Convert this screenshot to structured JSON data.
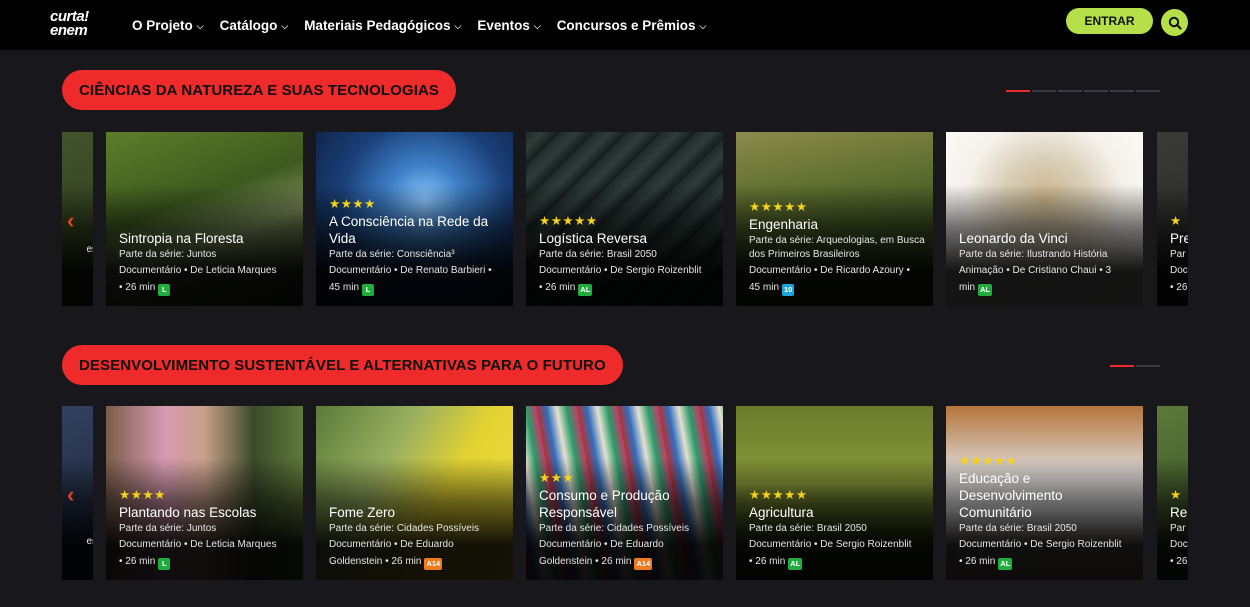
{
  "logo": {
    "line1": "curta!",
    "line2": "enem"
  },
  "nav": {
    "items": [
      {
        "label": "O Projeto"
      },
      {
        "label": "Catálogo"
      },
      {
        "label": "Materiais Pedagógicos"
      },
      {
        "label": "Eventos"
      },
      {
        "label": "Concursos e Prêmios"
      }
    ],
    "login_label": "ENTRAR"
  },
  "sections": [
    {
      "title": "CIÊNCIAS DA NATUREZA E SUAS TECNOLOGIAS",
      "pager": {
        "total": 6,
        "active": 1
      },
      "partial_left": {
        "meta": "es"
      },
      "cards": [
        {
          "stars": "",
          "title": "Sintropia na Floresta",
          "series": "Parte da série: Juntos",
          "meta1": "Documentário • De Leticia Marques",
          "meta2": "• 26 min",
          "rating": "L",
          "rating_color": "#1fae3b",
          "bg": "linear-gradient(160deg,#5e7d2b 0%,#3e5a1f 40%,#7a8a5a 60%,#2c3a14 100%)"
        },
        {
          "stars": "★★★★",
          "title": "A Consciência na Rede da Vida",
          "series": "Parte da série: Consciência³",
          "meta1": "Documentário • De Renato Barbieri •",
          "meta2": "45 min",
          "rating": "L",
          "rating_color": "#1fae3b",
          "bg": "radial-gradient(circle at 55% 40%,#8ec9ff 0%,#3d7fc7 25%,#1a3f78 55%,#0b1a36 100%)"
        },
        {
          "stars": "★★★★★",
          "title": "Logística Reversa",
          "series": "Parte da série: Brasil 2050",
          "meta1": "Documentário • De Sergio Roizenblit",
          "meta2": "• 26 min",
          "rating": "AL",
          "rating_color": "#1fae3b",
          "bg": "repeating-linear-gradient(135deg,#1e2a28 0px,#2f3d3a 12px,#141c1b 24px)"
        },
        {
          "stars": "★★★★★",
          "title": "Engenharia",
          "series": "Parte da série: Arqueologias, em Busca dos Primeiros Brasileiros",
          "meta1": "Documentário • De Ricardo Azoury •",
          "meta2": "45 min",
          "rating": "10",
          "rating_color": "#1aa3dc",
          "bg": "linear-gradient(170deg,#8b8b4a 0%,#5d6d2f 35%,#3f5422 60%,#2a3816 100%)"
        },
        {
          "stars": "",
          "title": "Leonardo da Vinci",
          "series": "Parte da série: Ilustrando História",
          "meta1": "Animação • De Cristiano Chaui • 3",
          "meta2": "min",
          "rating": "AL",
          "rating_color": "#1fae3b",
          "bg": "radial-gradient(circle at 50% 40%,#c9b48a 0%,#d9cfb8 30%,#f4f1ea 55%,#ffffff 100%)"
        }
      ],
      "partial_right": {
        "stars": "★",
        "title": "Pre",
        "series": "Par",
        "meta": "Doc",
        "meta2": "• 26"
      }
    },
    {
      "title": "DESENVOLVIMENTO SUSTENTÁVEL E ALTERNATIVAS PARA O FUTURO",
      "pager": {
        "total": 2,
        "active": 1
      },
      "partial_left": {
        "meta": "es"
      },
      "cards": [
        {
          "stars": "★★★★",
          "title": "Plantando nas Escolas",
          "series": "Parte da série: Juntos",
          "meta1": "Documentário • De Leticia Marques",
          "meta2": "• 26 min",
          "rating": "L",
          "rating_color": "#1fae3b",
          "bg": "linear-gradient(90deg,#7a5d4a 0%,#d89ab0 30%,#c8a08a 50%,#3b4a2a 75%,#5f7a3a 100%)"
        },
        {
          "stars": "",
          "title": "Fome Zero",
          "series": "Parte da série: Cidades Possíveis",
          "meta1": "Documentário • De Eduardo",
          "meta2": "Goldenstein • 26 min",
          "rating": "A14",
          "rating_color": "#f07a1e",
          "bg": "linear-gradient(120deg,#5a7a3a 0%,#9ab060 35%,#e2d232 60%,#f0e040 100%)"
        },
        {
          "stars": "★★★",
          "title": "Consumo e Produção Responsável",
          "series": "Parte da série: Cidades Possíveis",
          "meta1": "Documentário • De Eduardo",
          "meta2": "Goldenstein • 26 min",
          "rating": "A14",
          "rating_color": "#f07a1e",
          "bg": "repeating-linear-gradient(80deg,#b5322e 0px,#2f6ec0 10px,#e6e0d0 20px,#2a9b6a 30px,#c53a6a 40px)"
        },
        {
          "stars": "★★★★★",
          "title": "Agricultura",
          "series": "Parte da série: Brasil 2050",
          "meta1": "Documentário • De Sergio Roizenblit",
          "meta2": "• 26 min",
          "rating": "AL",
          "rating_color": "#1fae3b",
          "bg": "linear-gradient(180deg,#6a7a2a 0%,#8a9a3a 45%,#4a5a1e 70%,#2a3510 100%)"
        },
        {
          "stars": "★★★★★",
          "title": "Educação e Desenvolvimento Comunitário",
          "series": "Parte da série: Brasil 2050",
          "meta1": "Documentário • De Sergio Roizenblit",
          "meta2": "• 26 min",
          "rating": "AL",
          "rating_color": "#1fae3b",
          "bg": "linear-gradient(180deg,#b5753a 0%,#d8d0c8 35%,#f0f0f4 60%,#9a8a7a 100%)"
        }
      ],
      "partial_right": {
        "stars": "★",
        "title": "Re",
        "series": "Par",
        "meta": "Doc",
        "meta2": "• 26"
      }
    }
  ]
}
